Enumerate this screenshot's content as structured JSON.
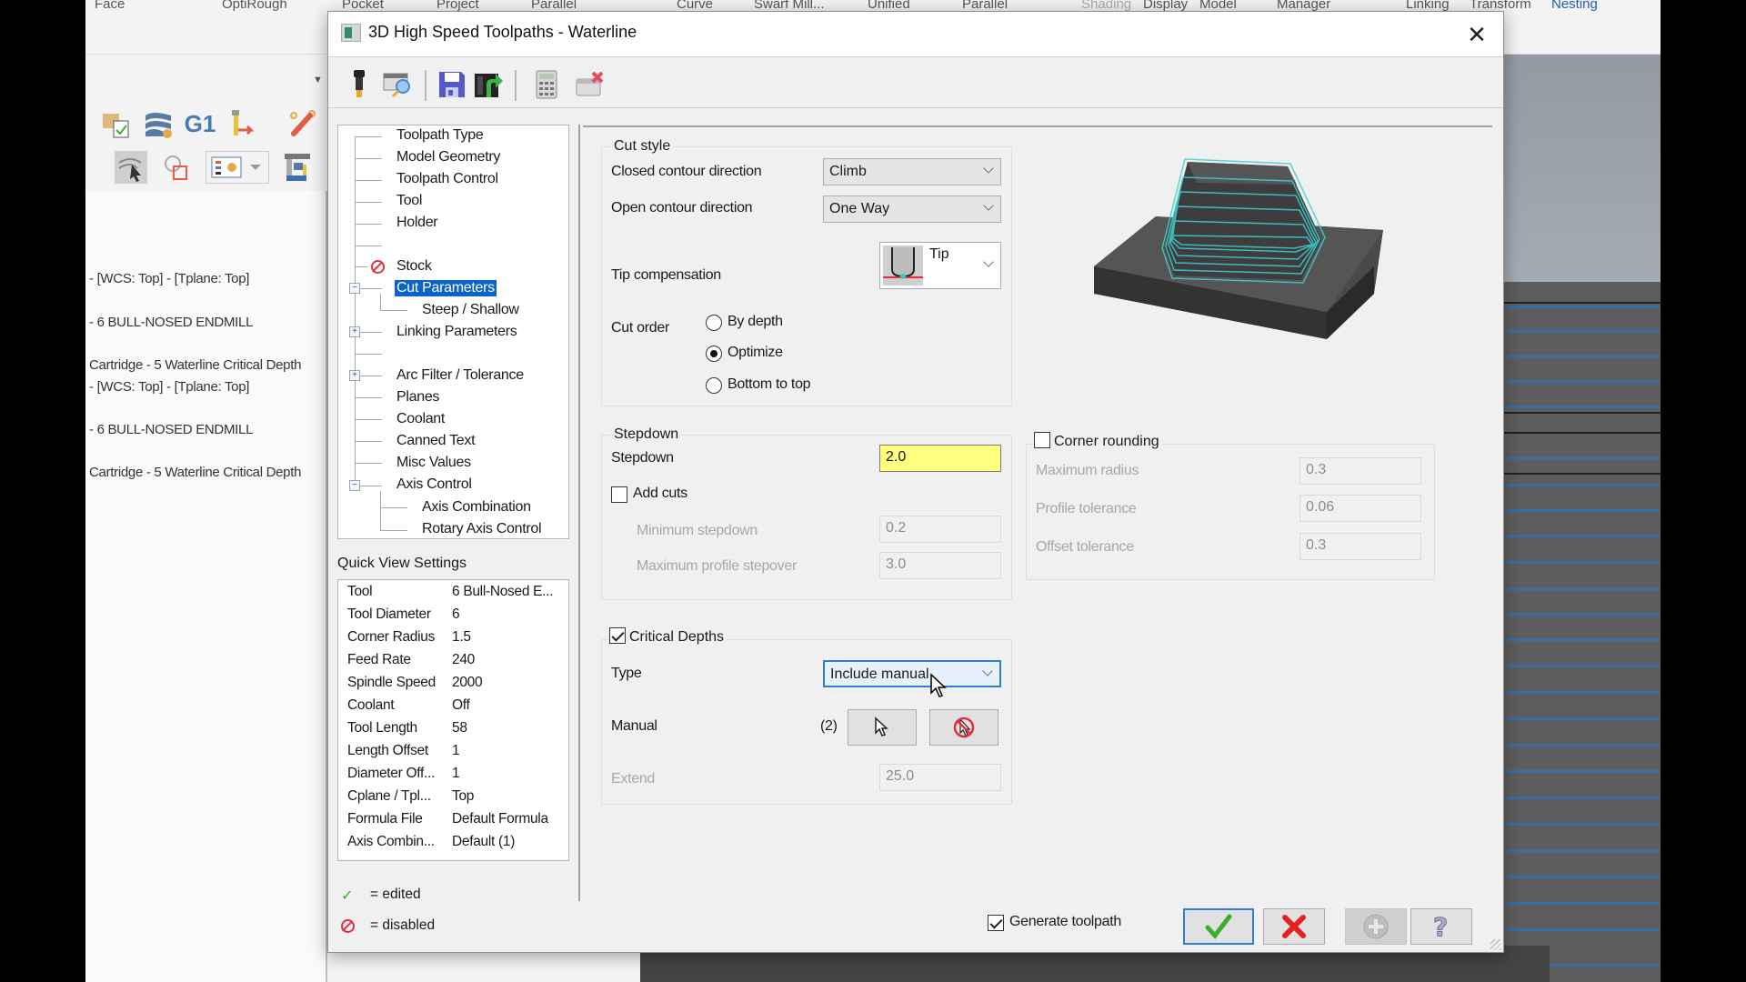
{
  "background_app": {
    "ribbon_tabs": [
      "Face",
      "OptiRough",
      "Pocket",
      "Project",
      "Parallel",
      "Curve",
      "Swarf Mill...",
      "Unified",
      "Parallel",
      "Shading",
      "Display",
      "Model",
      "Manager",
      "Linking",
      "Transform",
      "Nesting"
    ],
    "toolbar_icons": [
      "stock-model-icon",
      "waves-settings-icon",
      "g1-code-icon",
      "tool-post-icon",
      "pencil-line-icon",
      "select-toolpath-icon",
      "shape-select-icon",
      "display-settings-icon",
      "machine-simulate-icon"
    ],
    "g1_label": "G1",
    "operations_manager_lines": [
      "- [WCS: Top] - [Tplane: Top]",
      "- 6 BULL-NOSED ENDMILL",
      "Cartridge - 5 Waterline Critical Depth",
      "- [WCS: Top] - [Tplane: Top]",
      "- 6 BULL-NOSED ENDMILL",
      "Cartridge - 5 Waterline Critical Depth"
    ]
  },
  "dialog": {
    "title": "3D High Speed Toolpaths - Waterline",
    "toolbar": [
      "tool-icon",
      "table-search-icon",
      "save-icon",
      "export-icon",
      "calculator-icon",
      "remove-window-icon"
    ],
    "tree": [
      {
        "label": "Toolpath Type"
      },
      {
        "label": "Model Geometry"
      },
      {
        "label": "Toolpath Control"
      },
      {
        "label": "Tool"
      },
      {
        "label": "Holder"
      },
      {
        "label": ""
      },
      {
        "label": "Stock",
        "status": "disabled"
      },
      {
        "label": "Cut Parameters",
        "selected": true,
        "expander": "minus"
      },
      {
        "label": "Steep / Shallow",
        "child": true
      },
      {
        "label": "Linking Parameters",
        "expander": "plus"
      },
      {
        "label": ""
      },
      {
        "label": "Arc Filter / Tolerance",
        "expander": "plus"
      },
      {
        "label": "Planes"
      },
      {
        "label": "Coolant"
      },
      {
        "label": "Canned Text"
      },
      {
        "label": "Misc Values"
      },
      {
        "label": "Axis Control",
        "expander": "minus"
      },
      {
        "label": "Axis Combination",
        "child": true
      },
      {
        "label": "Rotary Axis Control",
        "child": true
      }
    ],
    "quick_view": {
      "label": "Quick View Settings",
      "rows": [
        {
          "key": "Tool",
          "value": "6 Bull-Nosed E..."
        },
        {
          "key": "Tool Diameter",
          "value": "6"
        },
        {
          "key": "Corner Radius",
          "value": "1.5"
        },
        {
          "key": "Feed Rate",
          "value": "240"
        },
        {
          "key": "Spindle Speed",
          "value": "2000"
        },
        {
          "key": "Coolant",
          "value": "Off"
        },
        {
          "key": "Tool Length",
          "value": "58"
        },
        {
          "key": "Length Offset",
          "value": "1"
        },
        {
          "key": "Diameter Off...",
          "value": "1"
        },
        {
          "key": "Cplane / Tpl...",
          "value": "Top"
        },
        {
          "key": "Formula File",
          "value": "Default Formula"
        },
        {
          "key": "Axis Combin...",
          "value": "Default (1)"
        }
      ]
    },
    "legend": {
      "edited": "= edited",
      "disabled": "= disabled"
    },
    "cut_style": {
      "title": "Cut style",
      "closed_contour_label": "Closed contour direction",
      "closed_contour_value": "Climb",
      "open_contour_label": "Open contour direction",
      "open_contour_value": "One Way",
      "tip_comp_label": "Tip compensation",
      "tip_comp_value": "Tip",
      "cut_order_label": "Cut order",
      "cut_order_options": [
        "By depth",
        "Optimize",
        "Bottom to top"
      ],
      "cut_order_selected": "Optimize"
    },
    "stepdown": {
      "title": "Stepdown",
      "stepdown_label": "Stepdown",
      "stepdown_value": "2.0",
      "add_cuts_label": "Add cuts",
      "add_cuts_checked": false,
      "min_stepdown_label": "Minimum stepdown",
      "min_stepdown_value": "0.2",
      "max_stepover_label": "Maximum profile stepover",
      "max_stepover_value": "3.0"
    },
    "corner_rounding": {
      "title": "Corner rounding",
      "checked": false,
      "max_radius_label": "Maximum radius",
      "max_radius_value": "0.3",
      "profile_tol_label": "Profile tolerance",
      "profile_tol_value": "0.06",
      "offset_tol_label": "Offset tolerance",
      "offset_tol_value": "0.3"
    },
    "critical_depths": {
      "title": "Critical Depths",
      "checked": true,
      "type_label": "Type",
      "type_value": "Include manual",
      "manual_label": "Manual",
      "manual_count": "(2)",
      "extend_label": "Extend",
      "extend_value": "25.0"
    },
    "footer": {
      "generate_label": "Generate toolpath",
      "generate_checked": true,
      "ok_icon": "check-icon",
      "cancel_icon": "x-icon",
      "add_icon": "plus-icon",
      "help_icon": "question-icon"
    },
    "colors": {
      "selection": "#0a64c8",
      "highlight_field": "#ffff80",
      "toolpath": "#3fd0d0",
      "ok_green": "#3cae2c",
      "cancel_red": "#e52222"
    }
  }
}
